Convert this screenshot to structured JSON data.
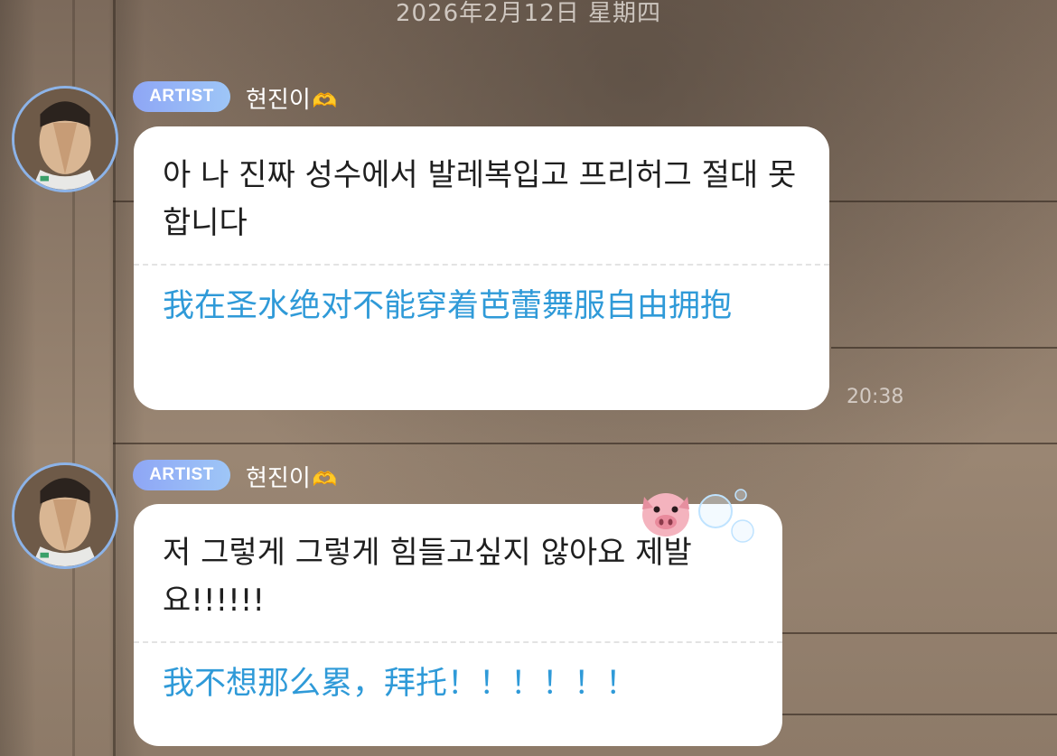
{
  "date_header": "2026年2月12日 星期四",
  "messages": [
    {
      "badge": "ARTIST",
      "sender": "현진이",
      "original": "아 나 진짜 성수에서 발레복입고 프리허그 절대 못합니다",
      "translation": "我在圣水绝对不能穿着芭蕾舞服自由拥抱",
      "time": "20:38"
    },
    {
      "badge": "ARTIST",
      "sender": "현진이",
      "original": "저 그렇게 그렇게 힘들고싶지 않아요 제발요!!!!!!",
      "translation": "我不想那么累，拜托！！！！！！"
    }
  ],
  "colors": {
    "badge_gradient_start": "#8ea6f5",
    "badge_gradient_end": "#9ec6f7",
    "translation_text": "#2f9ad8",
    "avatar_ring": "#8cb3e8"
  },
  "icons": {
    "sender_emoji": "heart-hands-icon",
    "sticker": "pig-face-icon",
    "decor": "bubbles-icon"
  }
}
